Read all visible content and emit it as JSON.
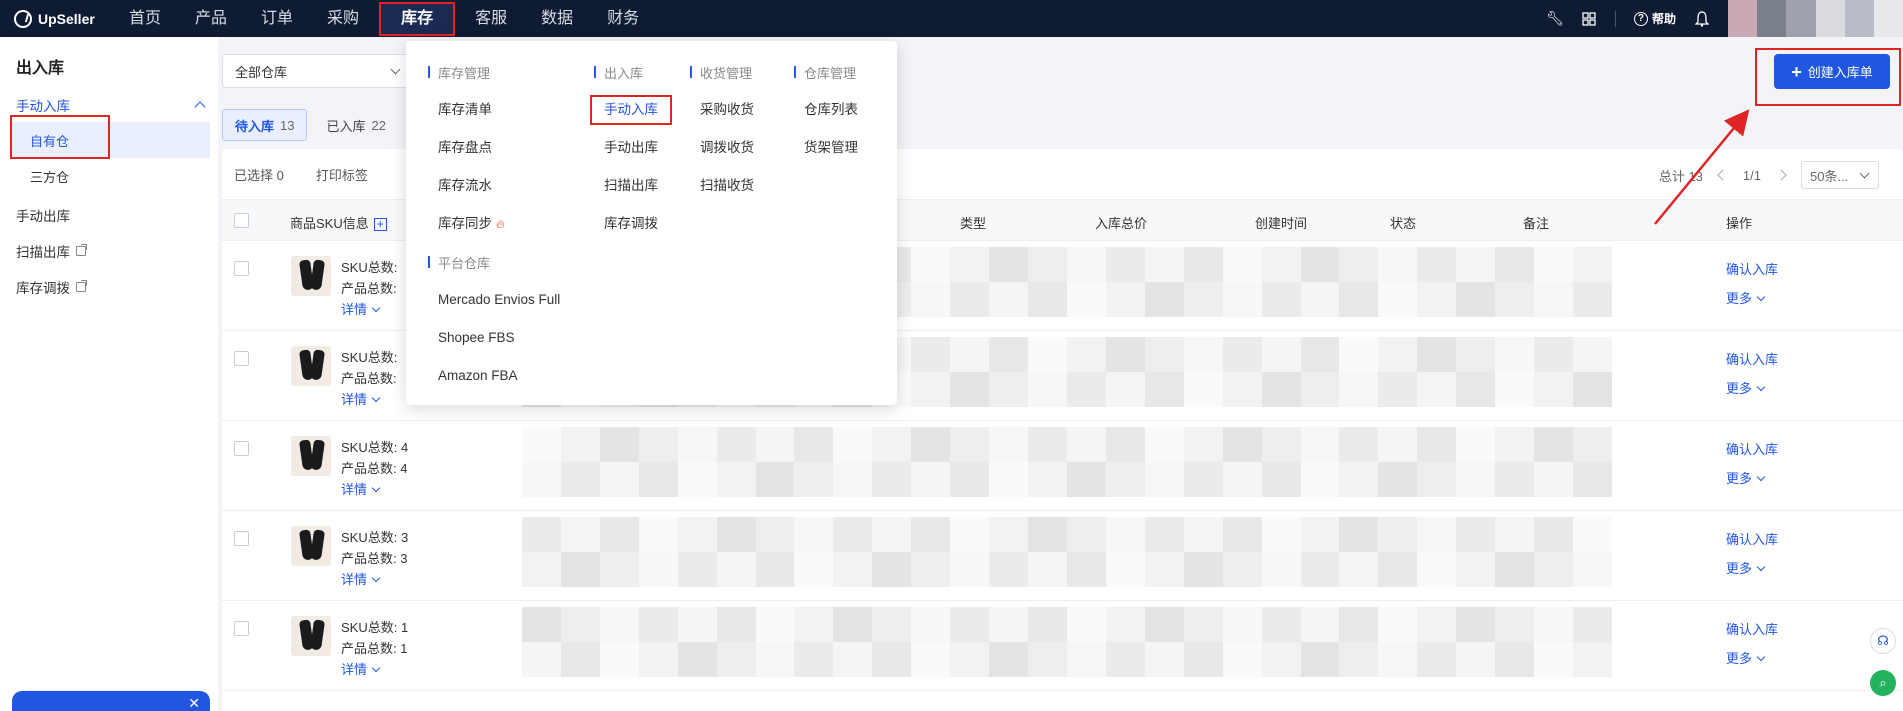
{
  "app": {
    "name": "UpSeller"
  },
  "nav": {
    "items": [
      "首页",
      "产品",
      "订单",
      "采购",
      "库存",
      "客服",
      "数据",
      "财务"
    ],
    "active_index": 4,
    "help_label": "帮助"
  },
  "sidebar": {
    "title": "出入库",
    "group_label": "手动入库",
    "sub_items": [
      "自有仓",
      "三方仓"
    ],
    "items": [
      "手动出库",
      "扫描出库",
      "库存调拨"
    ]
  },
  "dropdown": {
    "sections": [
      {
        "title": "库存管理",
        "items": [
          "库存清单",
          "库存盘点",
          "库存流水",
          "库存同步"
        ]
      },
      {
        "title": "平台仓库",
        "items": [
          "Mercado Envios Full",
          "Shopee FBS",
          "Amazon FBA"
        ]
      },
      {
        "title": "出入库",
        "items": [
          "手动入库",
          "手动出库",
          "扫描出库",
          "库存调拨"
        ]
      },
      {
        "title": "收货管理",
        "items": [
          "采购收货",
          "调拨收货",
          "扫描收货"
        ]
      },
      {
        "title": "仓库管理",
        "items": [
          "仓库列表",
          "货架管理"
        ]
      }
    ],
    "fire_icon": "fire-icon"
  },
  "main": {
    "warehouse_select": "全部仓库",
    "create_button": "创建入库单",
    "tabs": [
      {
        "label": "待入库",
        "count": "13"
      },
      {
        "label": "已入库",
        "count": "22"
      }
    ],
    "toolbar": {
      "selected": "已选择 0",
      "print": "打印标签"
    },
    "pager": {
      "total": "总计 13",
      "page": "1/1",
      "size": "50条..."
    },
    "columns": [
      "商品SKU信息",
      "类型",
      "入库总价",
      "创建时间",
      "状态",
      "备注",
      "操作"
    ],
    "rows": [
      {
        "sku": "SKU总数: ",
        "product": "产品总数: ",
        "details": "详情",
        "confirm": "确认入库",
        "more": "更多"
      },
      {
        "sku": "SKU总数: ",
        "product": "产品总数: ",
        "details": "详情",
        "confirm": "确认入库",
        "more": "更多"
      },
      {
        "sku": "SKU总数: 4",
        "product": "产品总数: 4",
        "details": "详情",
        "confirm": "确认入库",
        "more": "更多"
      },
      {
        "sku": "SKU总数: 3",
        "product": "产品总数: 3",
        "details": "详情",
        "confirm": "确认入库",
        "more": "更多"
      },
      {
        "sku": "SKU总数: 1",
        "product": "产品总数: 1",
        "details": "详情",
        "confirm": "确认入库",
        "more": "更多"
      }
    ]
  },
  "colors": {
    "nav_bg": "#0f1a33",
    "accent": "#2056e0",
    "highlight": "#e02424"
  }
}
